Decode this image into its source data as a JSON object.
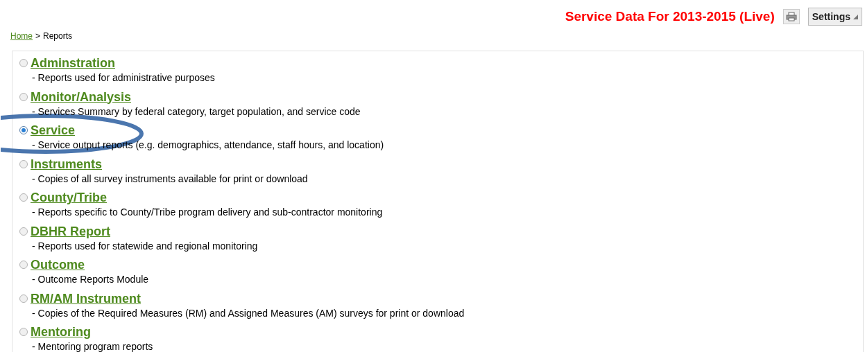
{
  "header": {
    "title": "Service Data For 2013-2015 (Live)",
    "settings_button": "Settings"
  },
  "breadcrumb": {
    "link": "Home",
    "separator": ">",
    "current": "Reports"
  },
  "annotation": {
    "kind": "ellipse"
  },
  "categories": [
    {
      "label": "Adminstration",
      "description": "- Reports used for administrative purposes",
      "selected": false
    },
    {
      "label": "Monitor/Analysis",
      "description": "- Services Summary by federal category, target population, and service code",
      "selected": false
    },
    {
      "label": "Service",
      "description": "- Service output reports (e.g. demographics, attendance, staff hours, and location)",
      "selected": true
    },
    {
      "label": "Instruments",
      "description": "- Copies of all survey instruments available for print or download",
      "selected": false
    },
    {
      "label": "County/Tribe",
      "description": "- Reports specific to County/Tribe program delivery and sub-contractor monitoring",
      "selected": false
    },
    {
      "label": "DBHR Report",
      "description": "- Reports used for statewide and regional monitoring",
      "selected": false
    },
    {
      "label": "Outcome",
      "description": "- Outcome Reports Module",
      "selected": false
    },
    {
      "label": "RM/AM Instrument",
      "description": "- Copies of the Required Measures (RM) and Assigned Measures (AM) surveys for print or download",
      "selected": false
    },
    {
      "label": "Mentoring",
      "description": "- Mentoring program reports",
      "selected": false
    }
  ]
}
